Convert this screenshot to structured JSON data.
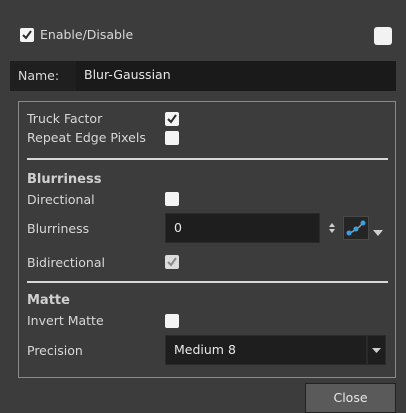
{
  "enable": {
    "label": "Enable/Disable",
    "checked": true
  },
  "color_swatch": {
    "color": "#f2f2f2"
  },
  "name": {
    "label": "Name:",
    "value": "Blur-Gaussian"
  },
  "options": {
    "truck_factor": {
      "label": "Truck Factor",
      "checked": true
    },
    "repeat_edge": {
      "label": "Repeat Edge Pixels",
      "checked": false
    }
  },
  "blurriness_section": {
    "title": "Blurriness",
    "directional": {
      "label": "Directional",
      "checked": false
    },
    "blurriness": {
      "label": "Blurriness",
      "value": "0",
      "spinner_icon": "up-down-arrows-icon",
      "function_icon": "function-curve-icon"
    },
    "bidirectional": {
      "label": "Bidirectional",
      "checked": true,
      "disabled": true
    }
  },
  "matte_section": {
    "title": "Matte",
    "invert_matte": {
      "label": "Invert Matte",
      "checked": false
    },
    "precision": {
      "label": "Precision",
      "value": "Medium 8"
    }
  },
  "close_button": {
    "label": "Close"
  },
  "colors": {
    "accent": "#3aa0e8",
    "field_bg": "#1e1e1e",
    "bg": "#3c3c3c"
  }
}
